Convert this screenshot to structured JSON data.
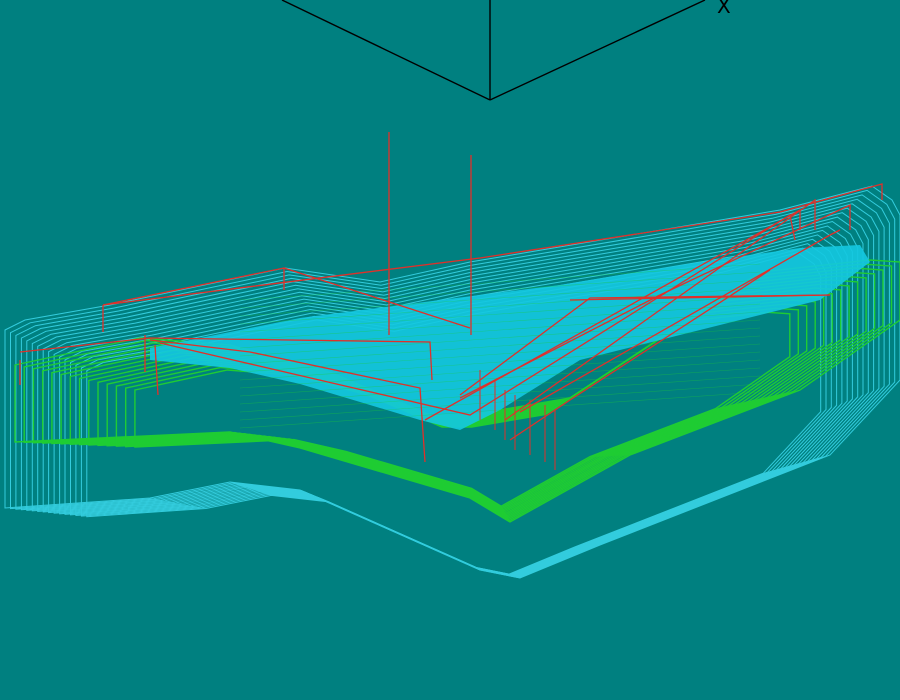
{
  "viewport": {
    "background": "#008080",
    "axis_color": "#000000",
    "axis_label_x": "X",
    "toolpath_colors": {
      "outer_contours": "#33ccdd",
      "inner_contours": "#1fcc33",
      "floor_fill": "#14c8e0",
      "rapid_moves": "#e0302a"
    }
  }
}
